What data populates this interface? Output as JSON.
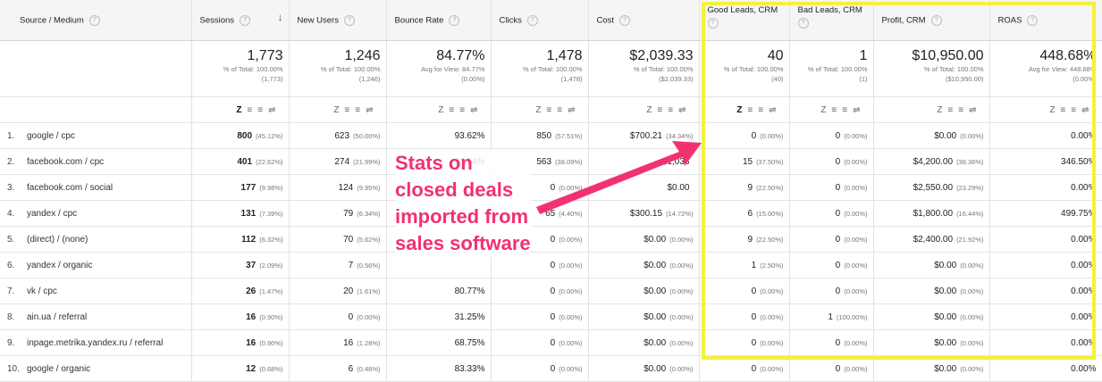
{
  "columns": [
    {
      "label": "Source / Medium"
    },
    {
      "label": "Sessions"
    },
    {
      "label": "New Users"
    },
    {
      "label": "Bounce Rate"
    },
    {
      "label": "Clicks"
    },
    {
      "label": "Cost"
    },
    {
      "label": "Good Leads, CRM"
    },
    {
      "label": "Bad Leads, CRM"
    },
    {
      "label": "Profit, CRM"
    },
    {
      "label": "ROAS"
    }
  ],
  "help_glyph": "?",
  "sort_arrow": "↓",
  "totals": [
    {
      "value": "1,773",
      "sub1": "% of Total: 100.00%",
      "sub2": "(1,773)"
    },
    {
      "value": "1,246",
      "sub1": "% of Total: 100.00%",
      "sub2": "(1,246)"
    },
    {
      "value": "84.77%",
      "sub1": "Avg for View: 84.77%",
      "sub2": "(0.00%)"
    },
    {
      "value": "1,478",
      "sub1": "% of Total: 100.00%",
      "sub2": "(1,478)"
    },
    {
      "value": "$2,039.33",
      "sub1": "% of Total: 100.00%",
      "sub2": "($2,039.33)"
    },
    {
      "value": "40",
      "sub1": "% of Total: 100.00%",
      "sub2": "(40)"
    },
    {
      "value": "1",
      "sub1": "% of Total: 100.00%",
      "sub2": "(1)"
    },
    {
      "value": "$10,950.00",
      "sub1": "% of Total: 100.00%",
      "sub2": "($10,950.00)"
    },
    {
      "value": "448.68%",
      "sub1": "Avg for View: 448.68%",
      "sub2": "(0.00%)"
    }
  ],
  "rows": [
    {
      "idx": "1.",
      "src": "google / cpc",
      "sessions": "800",
      "sessions_pct": "(45.12%)",
      "newusers": "623",
      "newusers_pct": "(50.00%)",
      "bounce": "93.62%",
      "clicks": "850",
      "clicks_pct": "(57.51%)",
      "cost": "$700.21",
      "cost_pct": "(34.34%)",
      "good": "0",
      "good_pct": "(0.00%)",
      "bad": "0",
      "bad_pct": "(0.00%)",
      "profit": "$0.00",
      "profit_pct": "(0.00%)",
      "roas": "0.00%"
    },
    {
      "idx": "2.",
      "src": "facebook.com / cpc",
      "sessions": "401",
      "sessions_pct": "(22.62%)",
      "newusers": "274",
      "newusers_pct": "(21.99%)",
      "bounce": "85.54%",
      "clicks": "563",
      "clicks_pct": "(38.09%)",
      "cost": "$1,038",
      "cost_pct": "",
      "good": "15",
      "good_pct": "(37.50%)",
      "bad": "0",
      "bad_pct": "(0.00%)",
      "profit": "$4,200.00",
      "profit_pct": "(38.36%)",
      "roas": "346.50%"
    },
    {
      "idx": "3.",
      "src": "facebook.com / social",
      "sessions": "177",
      "sessions_pct": "(9.98%)",
      "newusers": "124",
      "newusers_pct": "(9.95%)",
      "bounce": "",
      "clicks": "0",
      "clicks_pct": "(0.00%)",
      "cost": "$0.00",
      "cost_pct": "",
      "good": "9",
      "good_pct": "(22.50%)",
      "bad": "0",
      "bad_pct": "(0.00%)",
      "profit": "$2,550.00",
      "profit_pct": "(23.29%)",
      "roas": "0.00%"
    },
    {
      "idx": "4.",
      "src": "yandex / cpc",
      "sessions": "131",
      "sessions_pct": "(7.39%)",
      "newusers": "79",
      "newusers_pct": "(6.34%)",
      "bounce": "",
      "clicks": "65",
      "clicks_pct": "(4.40%)",
      "cost": "$300.15",
      "cost_pct": "(14.72%)",
      "good": "6",
      "good_pct": "(15.00%)",
      "bad": "0",
      "bad_pct": "(0.00%)",
      "profit": "$1,800.00",
      "profit_pct": "(16.44%)",
      "roas": "499.75%"
    },
    {
      "idx": "5.",
      "src": "(direct) / (none)",
      "sessions": "112",
      "sessions_pct": "(6.32%)",
      "newusers": "70",
      "newusers_pct": "(5.62%)",
      "bounce": "",
      "clicks": "0",
      "clicks_pct": "(0.00%)",
      "cost": "$0.00",
      "cost_pct": "(0.00%)",
      "good": "9",
      "good_pct": "(22.50%)",
      "bad": "0",
      "bad_pct": "(0.00%)",
      "profit": "$2,400.00",
      "profit_pct": "(21.92%)",
      "roas": "0.00%"
    },
    {
      "idx": "6.",
      "src": "yandex / organic",
      "sessions": "37",
      "sessions_pct": "(2.09%)",
      "newusers": "7",
      "newusers_pct": "(0.56%)",
      "bounce": "",
      "clicks": "0",
      "clicks_pct": "(0.00%)",
      "cost": "$0.00",
      "cost_pct": "(0.00%)",
      "good": "1",
      "good_pct": "(2.50%)",
      "bad": "0",
      "bad_pct": "(0.00%)",
      "profit": "$0.00",
      "profit_pct": "(0.00%)",
      "roas": "0.00%"
    },
    {
      "idx": "7.",
      "src": "vk / cpc",
      "sessions": "26",
      "sessions_pct": "(1.47%)",
      "newusers": "20",
      "newusers_pct": "(1.61%)",
      "bounce": "80.77%",
      "clicks": "0",
      "clicks_pct": "(0.00%)",
      "cost": "$0.00",
      "cost_pct": "(0.00%)",
      "good": "0",
      "good_pct": "(0.00%)",
      "bad": "0",
      "bad_pct": "(0.00%)",
      "profit": "$0.00",
      "profit_pct": "(0.00%)",
      "roas": "0.00%"
    },
    {
      "idx": "8.",
      "src": "ain.ua / referral",
      "sessions": "16",
      "sessions_pct": "(0.90%)",
      "newusers": "0",
      "newusers_pct": "(0.00%)",
      "bounce": "31.25%",
      "clicks": "0",
      "clicks_pct": "(0.00%)",
      "cost": "$0.00",
      "cost_pct": "(0.00%)",
      "good": "0",
      "good_pct": "(0.00%)",
      "bad": "1",
      "bad_pct": "(100.00%)",
      "profit": "$0.00",
      "profit_pct": "(0.00%)",
      "roas": "0.00%"
    },
    {
      "idx": "9.",
      "src": "inpage.metrika.yandex.ru / referral",
      "sessions": "16",
      "sessions_pct": "(0.90%)",
      "newusers": "16",
      "newusers_pct": "(1.28%)",
      "bounce": "68.75%",
      "clicks": "0",
      "clicks_pct": "(0.00%)",
      "cost": "$0.00",
      "cost_pct": "(0.00%)",
      "good": "0",
      "good_pct": "(0.00%)",
      "bad": "0",
      "bad_pct": "(0.00%)",
      "profit": "$0.00",
      "profit_pct": "(0.00%)",
      "roas": "0.00%"
    },
    {
      "idx": "10.",
      "src": "google / organic",
      "sessions": "12",
      "sessions_pct": "(0.68%)",
      "newusers": "6",
      "newusers_pct": "(0.48%)",
      "bounce": "83.33%",
      "clicks": "0",
      "clicks_pct": "(0.00%)",
      "cost": "$0.00",
      "cost_pct": "(0.00%)",
      "good": "0",
      "good_pct": "(0.00%)",
      "bad": "0",
      "bad_pct": "(0.00%)",
      "profit": "$0.00",
      "profit_pct": "(0.00%)",
      "roas": "0.00%"
    }
  ],
  "annotation": {
    "line1": "Stats on",
    "line2": "closed deals",
    "line3": "imported from",
    "line4": "sales software",
    "color": "#f2316e"
  },
  "highlight_color": "#f4f13b"
}
